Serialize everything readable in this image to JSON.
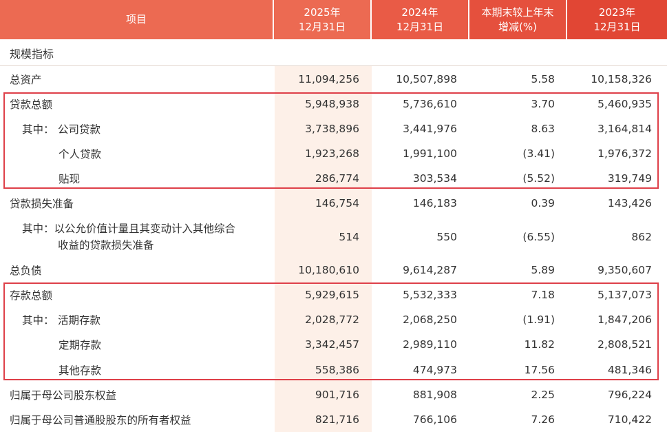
{
  "header": {
    "item_label": "项目",
    "col1": [
      "2025年",
      "12月31日"
    ],
    "col2": [
      "2024年",
      "12月31日"
    ],
    "col3": [
      "本期末较上年末",
      "增减(%)"
    ],
    "col4": [
      "2023年",
      "12月31日"
    ]
  },
  "section_title": "规模指标",
  "rows": [
    {
      "prefix": "",
      "label": "总资产",
      "v1": "11,094,256",
      "v2": "10,507,898",
      "v3": "5.58",
      "v4": "10,158,326"
    },
    {
      "prefix": "",
      "label": "贷款总额",
      "v1": "5,948,938",
      "v2": "5,736,610",
      "v3": "3.70",
      "v4": "5,460,935"
    },
    {
      "prefix": "其中：",
      "label": "公司贷款",
      "v1": "3,738,896",
      "v2": "3,441,976",
      "v3": "8.63",
      "v4": "3,164,814"
    },
    {
      "prefix": "",
      "label": "个人贷款",
      "v1": "1,923,268",
      "v2": "1,991,100",
      "v3": "(3.41)",
      "v4": "1,976,372"
    },
    {
      "prefix": "",
      "label": "贴现",
      "v1": "286,774",
      "v2": "303,534",
      "v3": "(5.52)",
      "v4": "319,749"
    },
    {
      "prefix": "",
      "label": "贷款损失准备",
      "v1": "146,754",
      "v2": "146,183",
      "v3": "0.39",
      "v4": "143,426"
    },
    {
      "prefix": "",
      "label": [
        "其中：以公允价值计量且其变动计入其他综合",
        "收益的贷款损失准备"
      ],
      "v1": "514",
      "v2": "550",
      "v3": "(6.55)",
      "v4": "862"
    },
    {
      "prefix": "",
      "label": "总负债",
      "v1": "10,180,610",
      "v2": "9,614,287",
      "v3": "5.89",
      "v4": "9,350,607"
    },
    {
      "prefix": "",
      "label": "存款总额",
      "v1": "5,929,615",
      "v2": "5,532,333",
      "v3": "7.18",
      "v4": "5,137,073"
    },
    {
      "prefix": "其中：",
      "label": "活期存款",
      "v1": "2,028,772",
      "v2": "2,068,250",
      "v3": "(1.91)",
      "v4": "1,847,206"
    },
    {
      "prefix": "",
      "label": "定期存款",
      "v1": "3,342,457",
      "v2": "2,989,110",
      "v3": "11.82",
      "v4": "2,808,521"
    },
    {
      "prefix": "",
      "label": "其他存款",
      "v1": "558,386",
      "v2": "474,973",
      "v3": "17.56",
      "v4": "481,346"
    },
    {
      "prefix": "",
      "label": "归属于母公司股东权益",
      "v1": "901,716",
      "v2": "881,908",
      "v3": "2.25",
      "v4": "796,224"
    },
    {
      "prefix": "",
      "label": "归属于母公司普通股股东的所有者权益",
      "v1": "821,716",
      "v2": "766,106",
      "v3": "7.26",
      "v4": "710,422"
    }
  ],
  "colors": {
    "header": "#e5503d",
    "highlight_box": "#de3f48",
    "shaded_column": "#fdf0e8"
  }
}
